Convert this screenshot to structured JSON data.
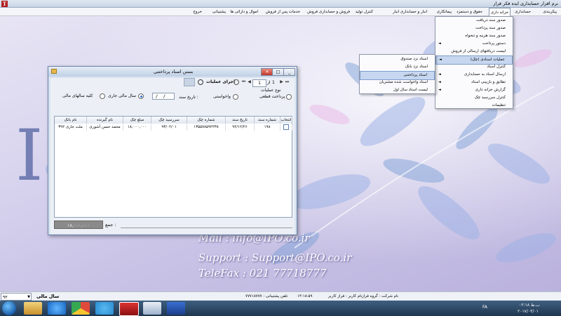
{
  "app": {
    "title": "نرم افزار حسابداری ایده فکر فراز",
    "logo": "T"
  },
  "menubar": {
    "items": [
      "پیکربندی",
      "حسابداری",
      "خزانه داری",
      "حقوق و دستمزد",
      "پیمانکاری",
      "انبار و حسابداری انبار",
      "کنترل تولید",
      "فروش و حسابداری فروش",
      "خدمات پس از فروش",
      "اموال و دارائی ها",
      "پشتیبانی",
      "خروج"
    ],
    "active_index": 2
  },
  "main_dropdown": {
    "items": [
      "صدور سند دریافت",
      "صدور سند پرداخت",
      "صدور سند هزینه و تنخواه",
      "دستور پرداخت",
      "لیست دریافتهای ارسالی از فروش",
      "عملیات اسنادی (چک)",
      "کنترل اسناد",
      "ارسال اسناد به حسابداری",
      "تطابق و بازبینی اسناد",
      "گزارش خزانه داری",
      "کنترل سررسید چک",
      "تنظیمات"
    ],
    "highlight_index": 5,
    "arrow_indices": [
      3,
      5,
      7,
      8,
      9
    ]
  },
  "sub_dropdown": {
    "items": [
      "اسناد نزد صندوق",
      "اسناد نزد بانک",
      "اسناد پرداختنی",
      "اسناد واخواست شده مشتریان",
      "لیست اسناد سال اول"
    ],
    "highlight_index": 2
  },
  "dialog": {
    "title": "بستن اسناد پرداختنی",
    "controls": [
      "_",
      "□",
      "✕"
    ],
    "run_label": "اجرای عملیات",
    "pager": {
      "current": "1",
      "of_label": "از",
      "total": "1"
    },
    "operation_type_label": "نوع عملیات",
    "op_options": [
      "پرداخت قطعی",
      "واخواستی"
    ],
    "op_selected": 0,
    "date_label": "تاریخ سند :",
    "date_value": " /  /",
    "year_options": [
      "سال مالی جاری",
      "کلیه سالهای مالی"
    ],
    "year_selected": 0,
    "columns": [
      "انتخاب",
      "شماره سند",
      "تاریخ سند",
      "شماره چک",
      "سررسید چک",
      "مبلغ چک",
      "نام گیرنده",
      "نام بانک"
    ],
    "rows": [
      {
        "selected": "",
        "doc_no": "۱۹۸",
        "doc_date": "۹۲/۱۲/۲۶",
        "check_no": "۱۳۵۵۷۸۵۹۲۲۳۸",
        "due_date": "۹۳/۰۲/۰۱",
        "amount": "۱۸,۰۰۰,۰۰۰",
        "payee": "محمد حسن آشوری",
        "bank": "ملت جاری ۳۹۲"
      }
    ],
    "total_label": "جمع :",
    "total_value": "۱۸,۰۰۰,۰۰۰"
  },
  "background": {
    "letter": "I",
    "mail": "Mail  :  info@IPO.co.ir",
    "support": "Support  :  Support@IPO.co.ir",
    "telefax": "TeleFax  :  021  77718777"
  },
  "statusbar": {
    "year_label": "سال مالی",
    "year_value": "۹۳",
    "company": "نام شرکت : گروه فراز",
    "user": "نام کاربر : فراز کاربر",
    "time": "۱۴:۱۸:۵۹",
    "support_phone": "تلفن پشتیبانی : ۷۷۷۱۸۷۷۷",
    "lang": "FA",
    "clock_time": "۰۲:۱۸ ب.ظ",
    "clock_date": "۲۰۱۷/۰۳/۰۱"
  },
  "taskbar": {
    "apps": [
      "explorer",
      "ie",
      "chrome",
      "telegram",
      "accounting-app",
      "paint",
      "word"
    ]
  }
}
